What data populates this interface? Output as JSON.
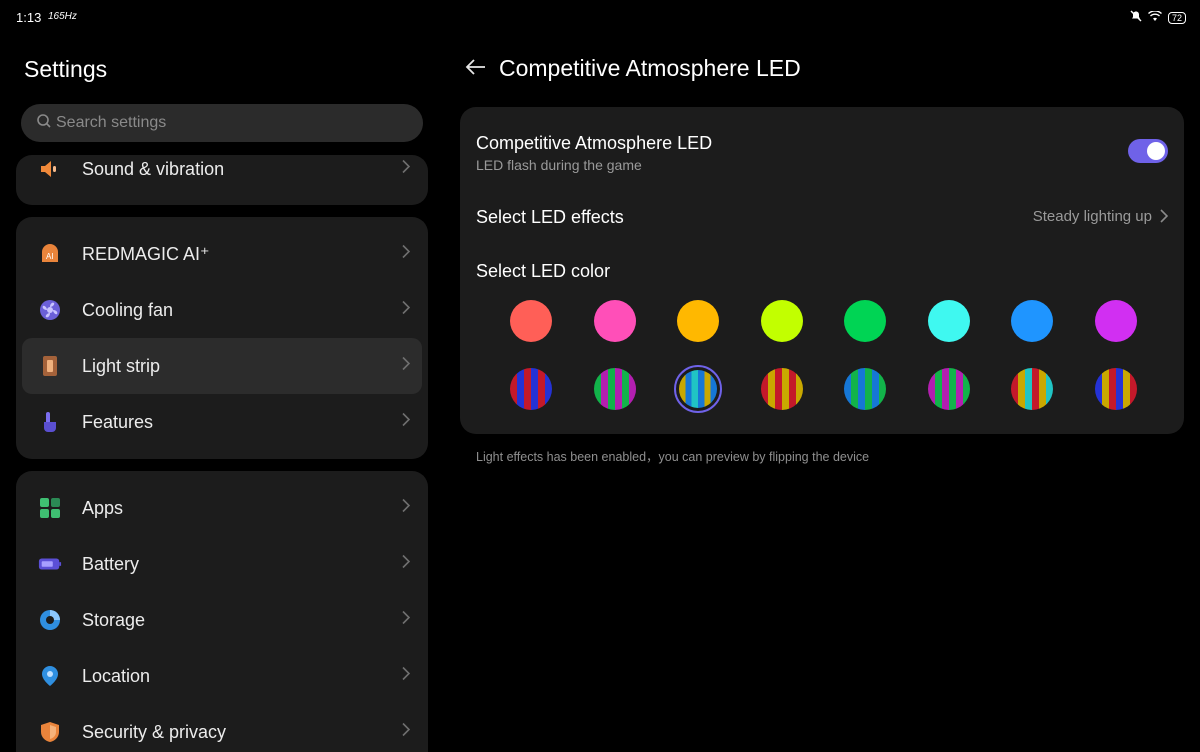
{
  "status": {
    "time": "1:13",
    "refresh": "165Hz",
    "battery": "72"
  },
  "left": {
    "title": "Settings",
    "search_placeholder": "Search settings",
    "group1": [
      {
        "label": "Sound & vibration",
        "icon": "speaker-icon"
      }
    ],
    "group2": [
      {
        "label": "REDMAGIC AI⁺",
        "icon": "ai-icon"
      },
      {
        "label": "Cooling fan",
        "icon": "fan-icon"
      },
      {
        "label": "Light strip",
        "icon": "light-strip-icon"
      },
      {
        "label": "Features",
        "icon": "hand-pointer-icon"
      }
    ],
    "group3": [
      {
        "label": "Apps",
        "icon": "apps-grid-icon"
      },
      {
        "label": "Battery",
        "icon": "battery-icon"
      },
      {
        "label": "Storage",
        "icon": "storage-pie-icon"
      },
      {
        "label": "Location",
        "icon": "location-pin-icon"
      },
      {
        "label": "Security & privacy",
        "icon": "shield-icon"
      }
    ]
  },
  "right": {
    "title": "Competitive Atmosphere LED",
    "toggle": {
      "title": "Competitive Atmosphere LED",
      "subtitle": "LED flash during the game",
      "on": true
    },
    "effects": {
      "label": "Select LED effects",
      "value": "Steady lighting up"
    },
    "color_label": "Select LED color",
    "solid_colors": [
      "#ff5f57",
      "#ff4fb8",
      "#ffb800",
      "#c2ff00",
      "#00d454",
      "#3ff8f0",
      "#1f95ff",
      "#d12ff2"
    ],
    "multi_colors": [
      [
        "#c4192a",
        "#2432d6",
        "#c4192a",
        "#2432d6",
        "#c4192a",
        "#2432d6"
      ],
      [
        "#12b34a",
        "#b31fb0",
        "#12b34a",
        "#b31fb0",
        "#12b34a",
        "#b31fb0"
      ],
      [
        "#c9a800",
        "#1677d6",
        "#20c4c4",
        "#1677d6",
        "#c9a800",
        "#1677d6"
      ],
      [
        "#c4192a",
        "#c9a800",
        "#c4192a",
        "#c9a800",
        "#c4192a",
        "#c9a800"
      ],
      [
        "#1677d6",
        "#12b34a",
        "#1677d6",
        "#12b34a",
        "#1677d6",
        "#12b34a"
      ],
      [
        "#b31fb0",
        "#12b34a",
        "#b31fb0",
        "#12b34a",
        "#b31fb0",
        "#12b34a"
      ],
      [
        "#c4192a",
        "#c9a800",
        "#20c4c4",
        "#c4192a",
        "#c9a800",
        "#20c4c4"
      ],
      [
        "#2432d6",
        "#c9a800",
        "#c4192a",
        "#2432d6",
        "#c9a800",
        "#c4192a"
      ]
    ],
    "selected_multi_index": 2,
    "hint": "Light effects has been enabled，you can preview by flipping the device"
  },
  "colors": {
    "accent": "#6f62e8",
    "card": "#1c1c1c",
    "background": "#000000"
  }
}
